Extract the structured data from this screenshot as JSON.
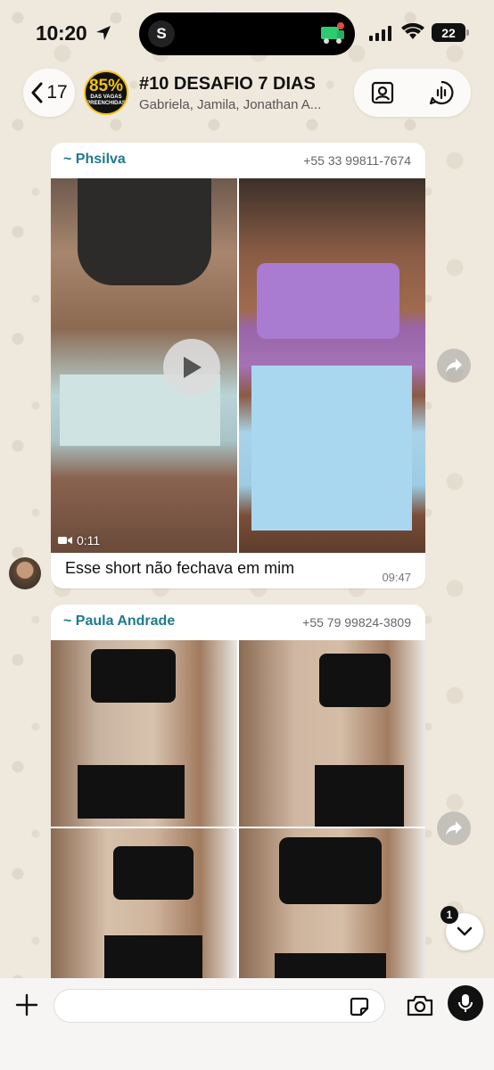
{
  "status_bar": {
    "time": "10:20",
    "island_letter": "S",
    "battery": "22"
  },
  "header": {
    "back_count": "17",
    "avatar_big": "85%",
    "avatar_small_1": "DAS VAGAS",
    "avatar_small_2": "PREENCHIDAS",
    "title": "#10 DESAFIO 7 DIAS",
    "members": "Gabriela, Jamila, Jonathan A..."
  },
  "messages": [
    {
      "sender": "~ Phsilva",
      "phone": "+55 33 99811-7674",
      "video_duration": "0:11",
      "caption": "Esse short não fechava em mim",
      "time": "09:47"
    },
    {
      "sender": "~ Paula Andrade",
      "phone": "+55 79 99824-3809"
    }
  ],
  "scroll": {
    "unread": "1"
  },
  "input": {
    "placeholder": ""
  },
  "colors": {
    "sender": "#1f7a8c",
    "background": "#efe8dc",
    "bubble": "#ffffff"
  }
}
